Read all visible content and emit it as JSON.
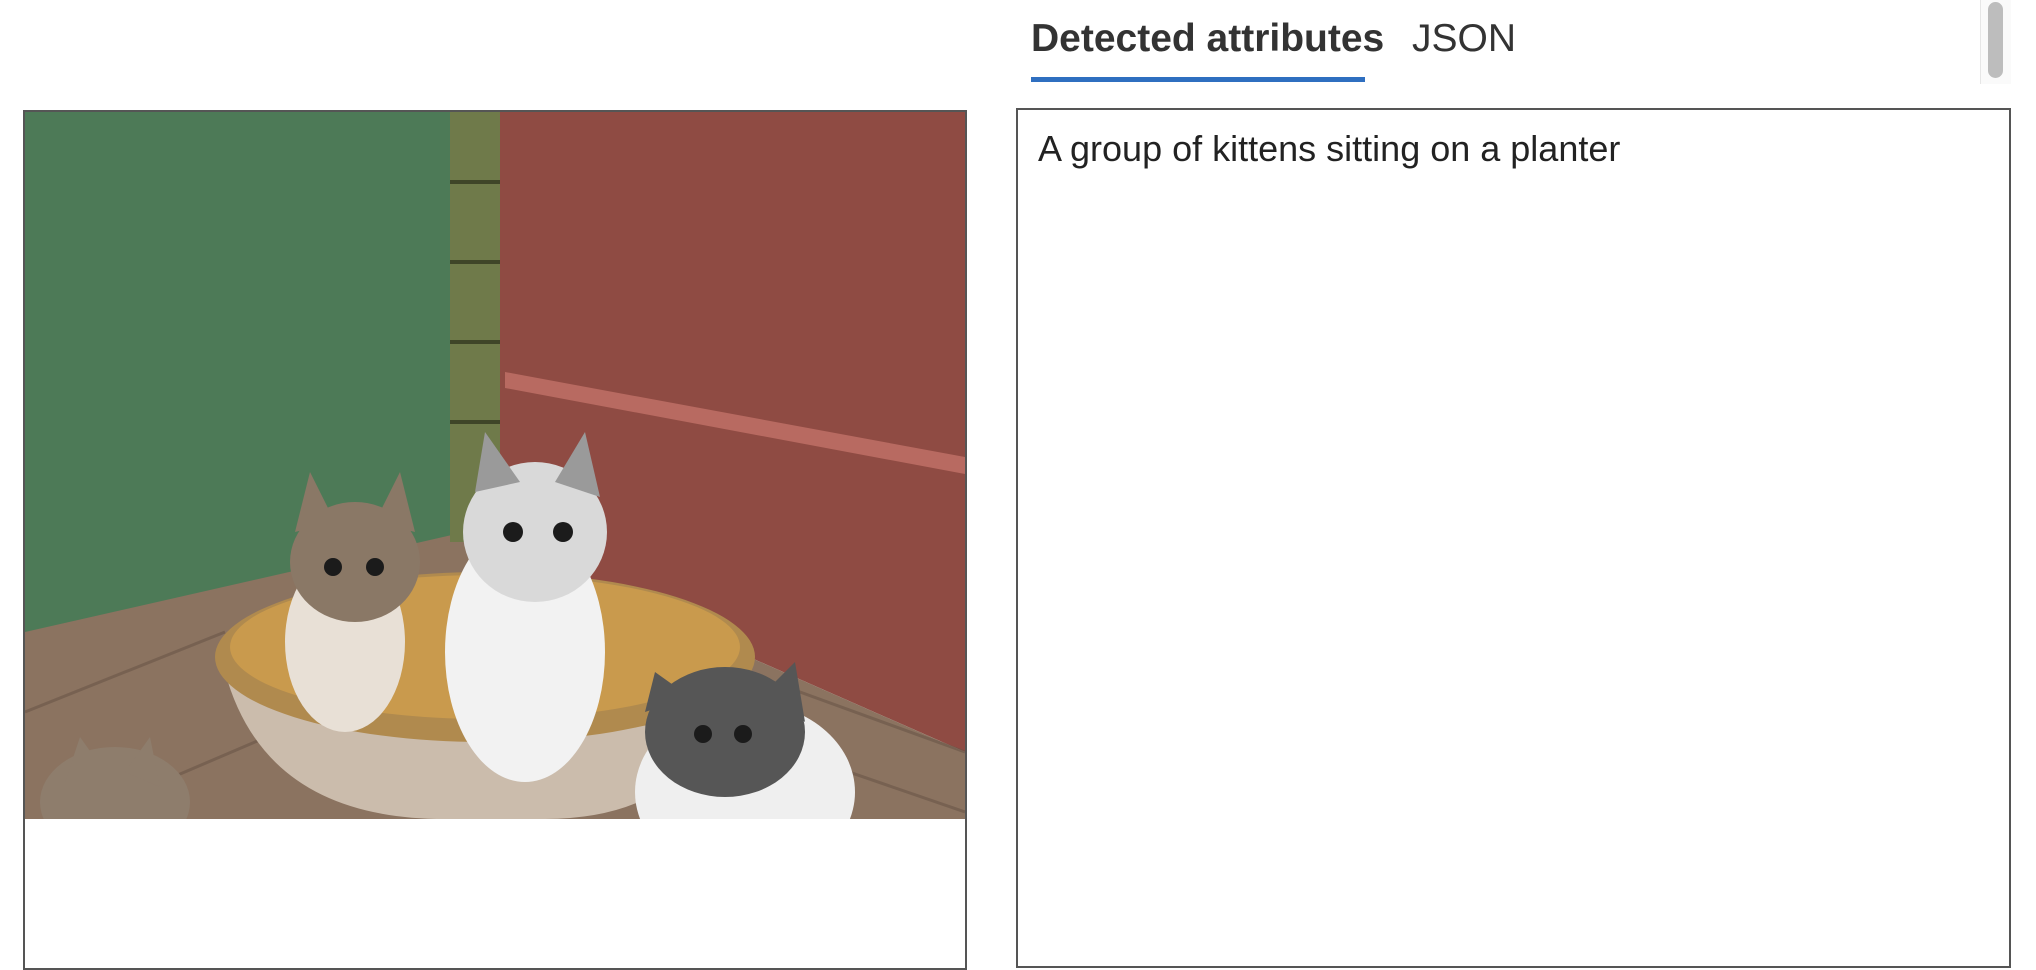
{
  "tabs": {
    "detected_label": "Detected attributes",
    "json_label": "JSON",
    "active": "Detected attributes"
  },
  "result": {
    "caption": "A group of kittens sitting on a planter"
  },
  "colors": {
    "accent": "#2f6fc0",
    "border": "#555555",
    "text": "#222222"
  }
}
